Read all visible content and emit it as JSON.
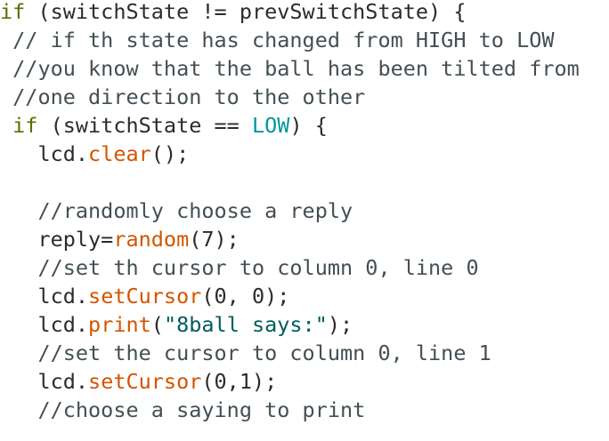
{
  "editor": {
    "lines": [
      {
        "tokens": [
          {
            "t": "if",
            "k": "keyword"
          },
          {
            "t": " (switchState != prevSwitchState) {",
            "k": "plain"
          }
        ]
      },
      {
        "tokens": [
          {
            "t": " // if th state has changed from HIGH to LOW",
            "k": "comment"
          }
        ]
      },
      {
        "tokens": [
          {
            "t": " //you know that the ball has been tilted from",
            "k": "comment"
          }
        ]
      },
      {
        "tokens": [
          {
            "t": " //one direction to the other",
            "k": "comment"
          }
        ]
      },
      {
        "tokens": [
          {
            "t": " ",
            "k": "plain"
          },
          {
            "t": "if",
            "k": "keyword"
          },
          {
            "t": " (switchState == ",
            "k": "plain"
          },
          {
            "t": "LOW",
            "k": "const"
          },
          {
            "t": ") {",
            "k": "plain"
          }
        ]
      },
      {
        "tokens": [
          {
            "t": "   lcd.",
            "k": "plain"
          },
          {
            "t": "clear",
            "k": "func"
          },
          {
            "t": "();",
            "k": "plain"
          }
        ]
      },
      {
        "tokens": []
      },
      {
        "tokens": [
          {
            "t": "   //randomly choose a reply",
            "k": "comment"
          }
        ]
      },
      {
        "tokens": [
          {
            "t": "   reply=",
            "k": "plain"
          },
          {
            "t": "random",
            "k": "func"
          },
          {
            "t": "(7);",
            "k": "plain"
          }
        ]
      },
      {
        "tokens": [
          {
            "t": "   //set th cursor to column 0, line 0",
            "k": "comment"
          }
        ]
      },
      {
        "tokens": [
          {
            "t": "   lcd.",
            "k": "plain"
          },
          {
            "t": "setCursor",
            "k": "func"
          },
          {
            "t": "(0, 0);",
            "k": "plain"
          }
        ]
      },
      {
        "tokens": [
          {
            "t": "   lcd.",
            "k": "plain"
          },
          {
            "t": "print",
            "k": "func"
          },
          {
            "t": "(",
            "k": "plain"
          },
          {
            "t": "\"8ball says:\"",
            "k": "string"
          },
          {
            "t": ");",
            "k": "plain"
          }
        ]
      },
      {
        "tokens": [
          {
            "t": "   //set the cursor to column 0, line 1",
            "k": "comment"
          }
        ]
      },
      {
        "tokens": [
          {
            "t": "   lcd.",
            "k": "plain"
          },
          {
            "t": "setCursor",
            "k": "func"
          },
          {
            "t": "(0,1);",
            "k": "plain"
          }
        ]
      },
      {
        "tokens": [
          {
            "t": "   //choose a saying to print",
            "k": "comment"
          }
        ]
      }
    ]
  }
}
